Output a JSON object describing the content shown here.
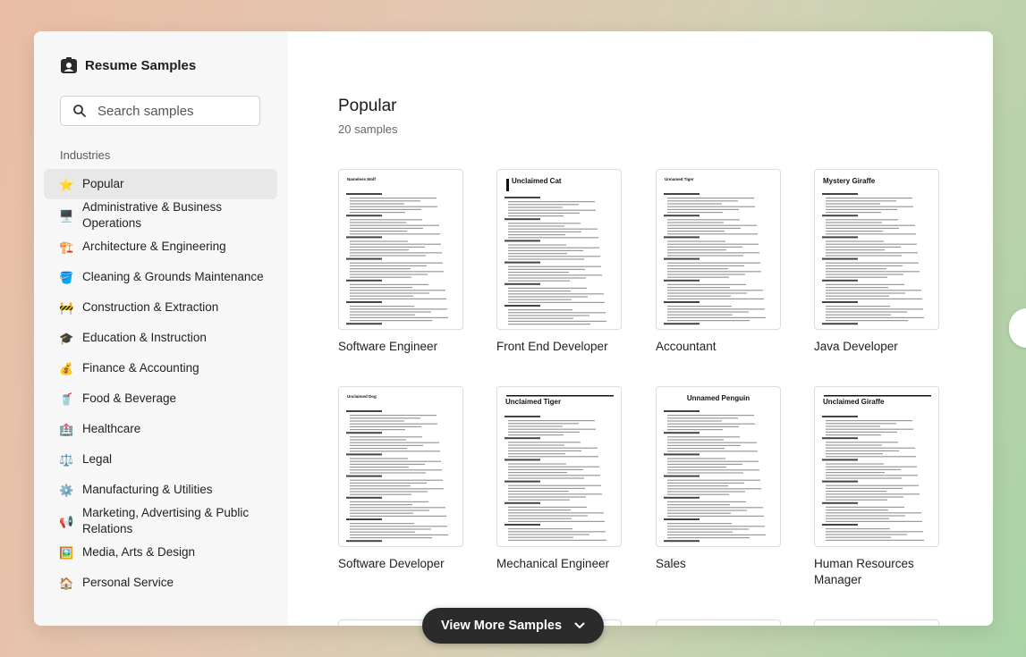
{
  "sidebar": {
    "title": "Resume Samples",
    "search_placeholder": "Search samples",
    "section_label": "Industries",
    "items": [
      {
        "label": "Popular",
        "emoji": "⭐",
        "icon": "star-icon",
        "active": true
      },
      {
        "label": "Administrative & Business Operations",
        "emoji": "🖥️",
        "icon": "computer-icon"
      },
      {
        "label": "Architecture & Engineering",
        "emoji": "🏗️",
        "icon": "building-construction-icon"
      },
      {
        "label": "Cleaning & Grounds Maintenance",
        "emoji": "🪣",
        "icon": "bucket-icon"
      },
      {
        "label": "Construction & Extraction",
        "emoji": "🚧",
        "icon": "construction-barrier-icon"
      },
      {
        "label": "Education & Instruction",
        "emoji": "🎓",
        "icon": "graduation-cap-icon"
      },
      {
        "label": "Finance & Accounting",
        "emoji": "💰",
        "icon": "money-bag-icon"
      },
      {
        "label": "Food & Beverage",
        "emoji": "🥤",
        "icon": "cup-icon"
      },
      {
        "label": "Healthcare",
        "emoji": "🏥",
        "icon": "hospital-icon"
      },
      {
        "label": "Legal",
        "emoji": "⚖️",
        "icon": "scales-icon"
      },
      {
        "label": "Manufacturing & Utilities",
        "emoji": "⚙️",
        "icon": "gear-icon"
      },
      {
        "label": "Marketing, Advertising & Public Relations",
        "emoji": "📢",
        "icon": "megaphone-icon"
      },
      {
        "label": "Media, Arts & Design",
        "emoji": "🖼️",
        "icon": "framed-picture-icon"
      },
      {
        "label": "Personal Service",
        "emoji": "🏠",
        "icon": "house-icon"
      }
    ]
  },
  "main": {
    "title": "Popular",
    "count": "20 samples",
    "samples": [
      {
        "label": "Software Engineer",
        "resume_name": "Nameless Wolf",
        "style": "plain"
      },
      {
        "label": "Front End Developer",
        "resume_name": "Unclaimed Cat",
        "style": "bar"
      },
      {
        "label": "Accountant",
        "resume_name": "Unnamed Tiger",
        "style": "plain"
      },
      {
        "label": "Java Developer",
        "resume_name": "Mystery Giraffe",
        "style": "plain"
      },
      {
        "label": "Software Developer",
        "resume_name": "Unclaimed Dog",
        "style": "plain"
      },
      {
        "label": "Mechanical Engineer",
        "resume_name": "Unclaimed Tiger",
        "style": "rule"
      },
      {
        "label": "Sales",
        "resume_name": "Unnamed Penguin",
        "style": "center"
      },
      {
        "label": "Human Resources Manager",
        "resume_name": "Unclaimed Giraffe",
        "style": "rule"
      }
    ]
  },
  "view_more": {
    "label": "View More Samples"
  }
}
